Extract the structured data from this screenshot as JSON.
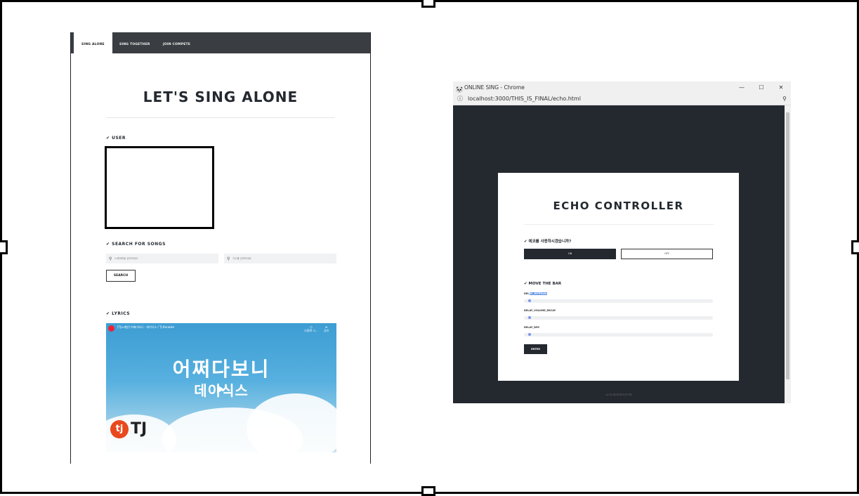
{
  "left": {
    "tabs": [
      "SING ALONE",
      "SING TOGETHER",
      "JOIN COMPETE"
    ],
    "title": "LET'S SING ALONE",
    "sections": {
      "user": "✔ USER",
      "search": "✔ SEARCH FOR SONGS",
      "lyrics": "✔ LYRICS"
    },
    "inputs": {
      "song_placeholder": "노래제목을 입력하세요",
      "singer_placeholder": "가수를 입력하세요"
    },
    "search_button": "SEARCH",
    "video": {
      "title": "[TJ노래방] 어쩌다보니 - 데이식스 / TJ Karaoke",
      "big_text": "어쩌다보니",
      "artist_text": "데이식스",
      "logo_text": "TJ",
      "logo_circle": "tj",
      "watch_later": "나중에 시...",
      "share": "공유"
    }
  },
  "right": {
    "window_title": "ONLINE SING - Chrome",
    "window_controls": [
      "—",
      "☐",
      "✕"
    ],
    "url": "localhost:3000/THIS_IS_FINAL/echo.html",
    "card_title": "ECHO CONTROLLER",
    "question": "✔ 에코를 사용하시겠습니까?",
    "on_label": "ON",
    "off_label": "OFF",
    "move_bar": "✔ MOVE THE BAR",
    "sliders": [
      {
        "label_prefix": "DEL",
        "label_highlight": "AY_INTERVAL"
      },
      {
        "label_prefix": "DELAY_VOLUME_DECAY",
        "label_highlight": ""
      },
      {
        "label_prefix": "DELAY_DRY",
        "label_highlight": ""
      }
    ],
    "enter_label": "ENTER",
    "footer": "all 한 페이지에 모든거에"
  },
  "colors": {
    "dark": "#242930",
    "accent": "#7a95ef"
  }
}
